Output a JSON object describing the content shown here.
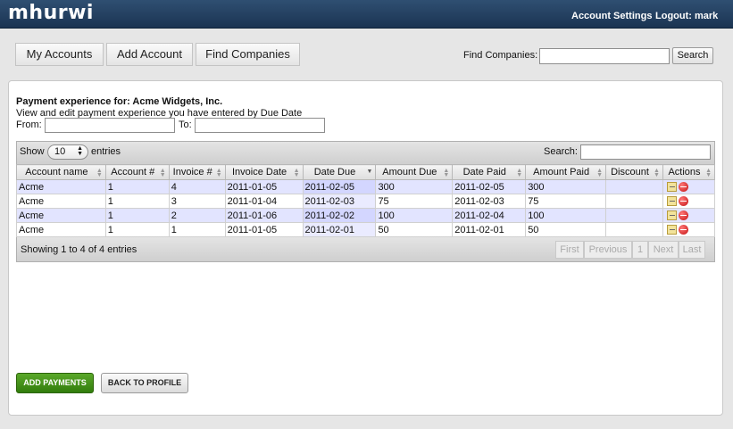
{
  "app": {
    "logo": "mhurwi"
  },
  "header": {
    "account_settings": "Account Settings",
    "logout": "Logout: mark"
  },
  "nav": {
    "my_accounts": "My Accounts",
    "add_account": "Add Account",
    "find_companies": "Find Companies"
  },
  "find": {
    "label": "Find Companies:",
    "value": "",
    "button": "Search"
  },
  "panel": {
    "heading": "Payment experience for: Acme Widgets, Inc.",
    "subtext": "View and edit payment experience you have entered by Due Date",
    "from_label": "From:",
    "from_value": "",
    "to_label": "To:",
    "to_value": ""
  },
  "table": {
    "show_label": "Show",
    "show_value": "10",
    "entries_label": "entries",
    "search_label": "Search:",
    "search_value": "",
    "columns": [
      "Account name",
      "Account #",
      "Invoice #",
      "Invoice Date",
      "Date Due",
      "Amount Due",
      "Date Paid",
      "Amount Paid",
      "Discount",
      "Actions"
    ],
    "sorted_column": "Date Due",
    "rows": [
      [
        "Acme",
        "1",
        "4",
        "2011-01-05",
        "2011-02-05",
        "300",
        "2011-02-05",
        "300",
        ""
      ],
      [
        "Acme",
        "1",
        "3",
        "2011-01-04",
        "2011-02-03",
        "75",
        "2011-02-03",
        "75",
        ""
      ],
      [
        "Acme",
        "1",
        "2",
        "2011-01-06",
        "2011-02-02",
        "100",
        "2011-02-04",
        "100",
        ""
      ],
      [
        "Acme",
        "1",
        "1",
        "2011-01-05",
        "2011-02-01",
        "50",
        "2011-02-01",
        "50",
        ""
      ]
    ],
    "action_icons": [
      "edit-icon",
      "delete-icon"
    ],
    "info": "Showing 1 to 4 of 4 entries",
    "pager": {
      "first": "First",
      "previous": "Previous",
      "page": "1",
      "next": "Next",
      "last": "Last"
    }
  },
  "buttons": {
    "add_payments": "ADD PAYMENTS",
    "back_to_profile": "BACK TO PROFILE"
  },
  "colors": {
    "topbar": "#1b3452",
    "odd_row": "#e2e4ff",
    "add_button": "#3f8f16"
  }
}
